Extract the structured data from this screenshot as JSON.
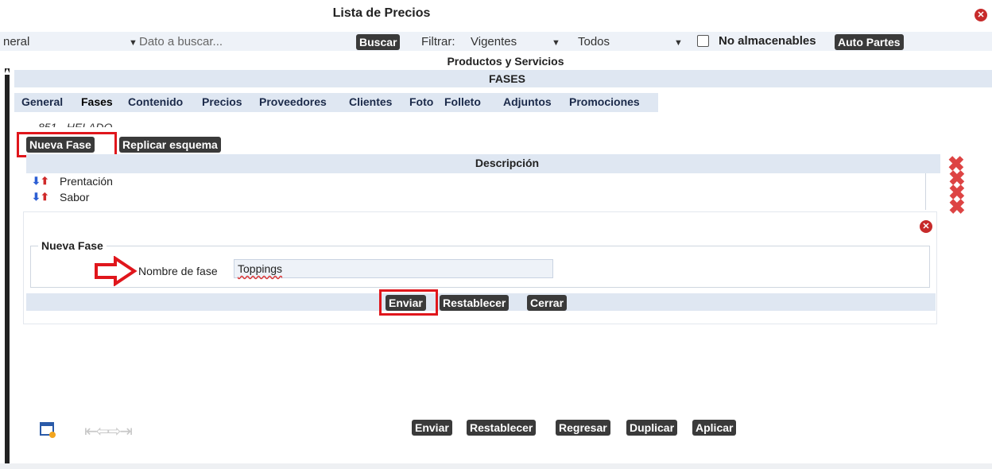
{
  "window": {
    "title": "Lista de Precios"
  },
  "toolbar": {
    "category_value": "neral",
    "search_placeholder": "Dato a buscar...",
    "search_button": "Buscar",
    "filter_label": "Filtrar:",
    "filter_value": "Vigentes",
    "scope_value": "Todos",
    "no_storable_label": "No almacenables",
    "auto_parts_button": "Auto Partes"
  },
  "section": {
    "title": "Productos y Servicios",
    "subtitle": "FASES"
  },
  "tabs": [
    "General",
    "Fases",
    "Contenido",
    "Precios",
    "Proveedores",
    "Clientes",
    "Foto",
    "Folleto",
    "Adjuntos",
    "Promociones"
  ],
  "product": {
    "name": "851 - HELADO..."
  },
  "actions": {
    "new_phase": "Nueva Fase",
    "replicate": "Replicar esquema"
  },
  "table": {
    "header": "Descripción",
    "rows": [
      {
        "label": "Prentación"
      },
      {
        "label": "Sabor"
      }
    ]
  },
  "dialog": {
    "legend": "Nueva Fase",
    "field_label": "Nombre de fase",
    "field_value": "Toppings",
    "buttons": {
      "send": "Enviar",
      "reset": "Restablecer",
      "close": "Cerrar"
    }
  },
  "footer": {
    "buttons": {
      "send": "Enviar",
      "reset": "Restablecer",
      "back": "Regresar",
      "duplicate": "Duplicar",
      "apply": "Aplicar"
    }
  },
  "colors": {
    "accent_red": "#e0161c",
    "button_dark": "#3a3a3a",
    "header_bg": "#dfe7f2"
  }
}
